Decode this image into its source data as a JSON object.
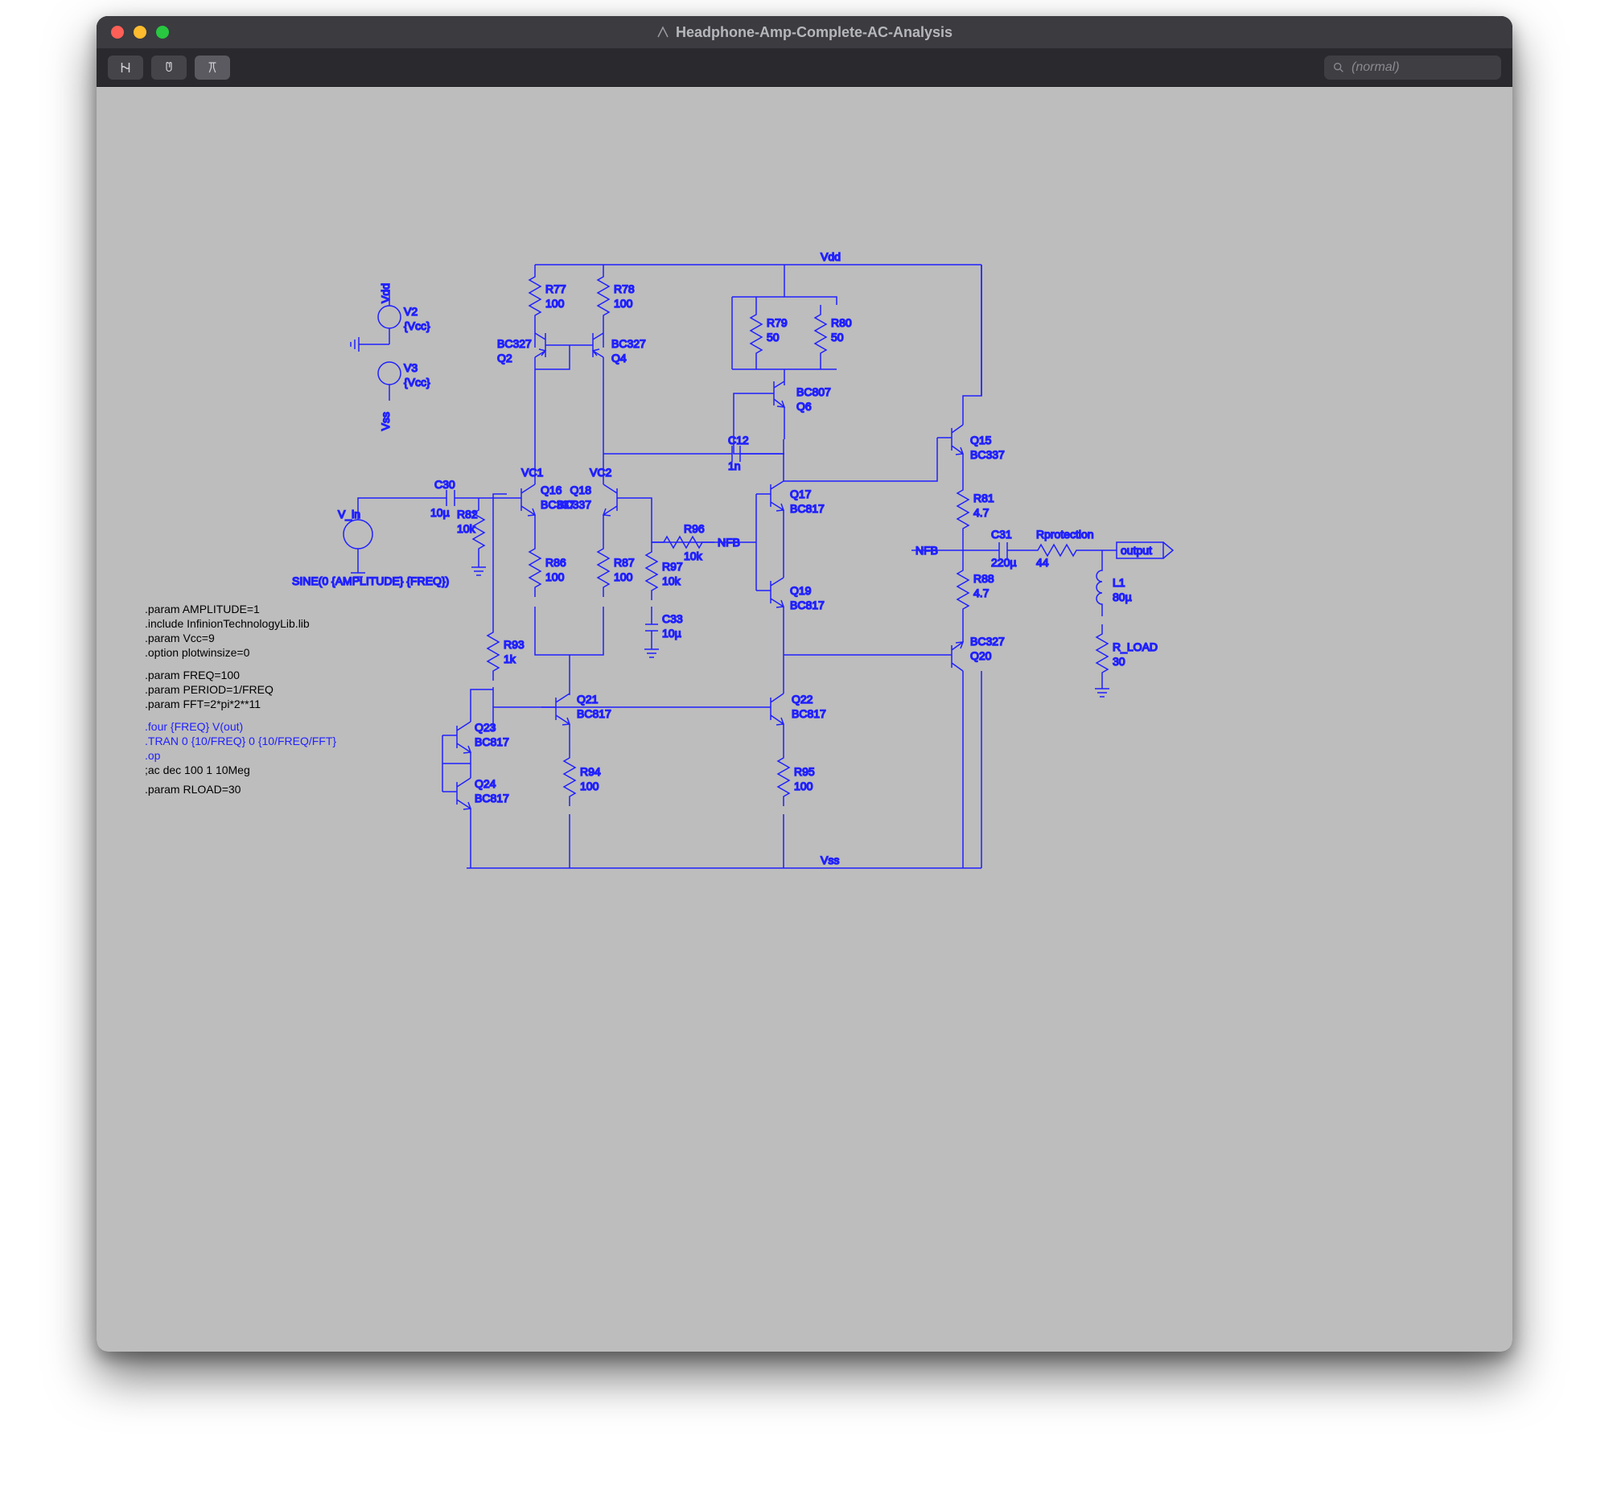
{
  "window": {
    "title": "Headphone-Amp-Complete-AC-Analysis"
  },
  "toolbar": {
    "search_placeholder": "(normal)"
  },
  "rails": {
    "vdd": "Vdd",
    "vss": "Vss"
  },
  "sources": {
    "v2": {
      "name": "V2",
      "val": "{Vcc}",
      "rail": "Vdd"
    },
    "v3": {
      "name": "V3",
      "val": "{Vcc}",
      "rail": "Vss"
    },
    "vin": {
      "name": "V_in",
      "val": "SINE(0 {AMPLITUDE} {FREQ})"
    }
  },
  "caps": {
    "c30": {
      "name": "C30",
      "val": "10µ"
    },
    "c12": {
      "name": "C12",
      "val": "1n"
    },
    "c33": {
      "name": "C33",
      "val": "10µ"
    },
    "c31": {
      "name": "C31",
      "val": "220µ"
    }
  },
  "res": {
    "r77": {
      "name": "R77",
      "val": "100"
    },
    "r78": {
      "name": "R78",
      "val": "100"
    },
    "r79": {
      "name": "R79",
      "val": "50"
    },
    "r80": {
      "name": "R80",
      "val": "50"
    },
    "r81": {
      "name": "R81",
      "val": "4.7"
    },
    "r82": {
      "name": "R82",
      "val": "10k"
    },
    "r86": {
      "name": "R86",
      "val": "100"
    },
    "r87": {
      "name": "R87",
      "val": "100"
    },
    "r88": {
      "name": "R88",
      "val": "4.7"
    },
    "r93": {
      "name": "R93",
      "val": "1k"
    },
    "r94": {
      "name": "R94",
      "val": "100"
    },
    "r95": {
      "name": "R95",
      "val": "100"
    },
    "r96": {
      "name": "R96",
      "val": "10k"
    },
    "r97": {
      "name": "R97",
      "val": "10k"
    },
    "rprot": {
      "name": "Rprotection",
      "val": "44"
    },
    "rload": {
      "name": "R_LOAD",
      "val": "30"
    }
  },
  "ind": {
    "l1": {
      "name": "L1",
      "val": "80µ"
    }
  },
  "q": {
    "q2": {
      "name": "Q2",
      "model": "BC327"
    },
    "q4": {
      "name": "Q4",
      "model": "BC327"
    },
    "q6": {
      "name": "Q6",
      "model": "BC807"
    },
    "q15": {
      "name": "Q15",
      "model": "BC337"
    },
    "q16": {
      "name": "Q16",
      "model": "BC337"
    },
    "q17": {
      "name": "Q17",
      "model": "BC817"
    },
    "q18": {
      "name": "Q18",
      "model": "BC337"
    },
    "q19": {
      "name": "Q19",
      "model": "BC817"
    },
    "q20": {
      "name": "Q20",
      "model": "BC327"
    },
    "q21": {
      "name": "Q21",
      "model": "BC817"
    },
    "q22": {
      "name": "Q22",
      "model": "BC817"
    },
    "q23": {
      "name": "Q23",
      "model": "BC817"
    },
    "q24": {
      "name": "Q24",
      "model": "BC817"
    }
  },
  "nets": {
    "vc1": "VC1",
    "vc2": "VC2",
    "nfb": "NFB",
    "nfb2": "NFB",
    "output": "output"
  },
  "spice": {
    "l1": ".param AMPLITUDE=1",
    "l2": ".include InfinionTechnologyLib.lib",
    "l3": ".param Vcc=9",
    "l4": ".option plotwinsize=0",
    "l5": ".param FREQ=100",
    "l6": ".param PERIOD=1/FREQ",
    "l7": ".param FFT=2*pi*2**11",
    "l8": ".four {FREQ} V(out)",
    "l9": ".TRAN 0 {10/FREQ} 0 {10/FREQ/FFT}",
    "l10": ".op",
    "l11": ";ac dec 100 1 10Meg",
    "l12": ".param RLOAD=30"
  }
}
